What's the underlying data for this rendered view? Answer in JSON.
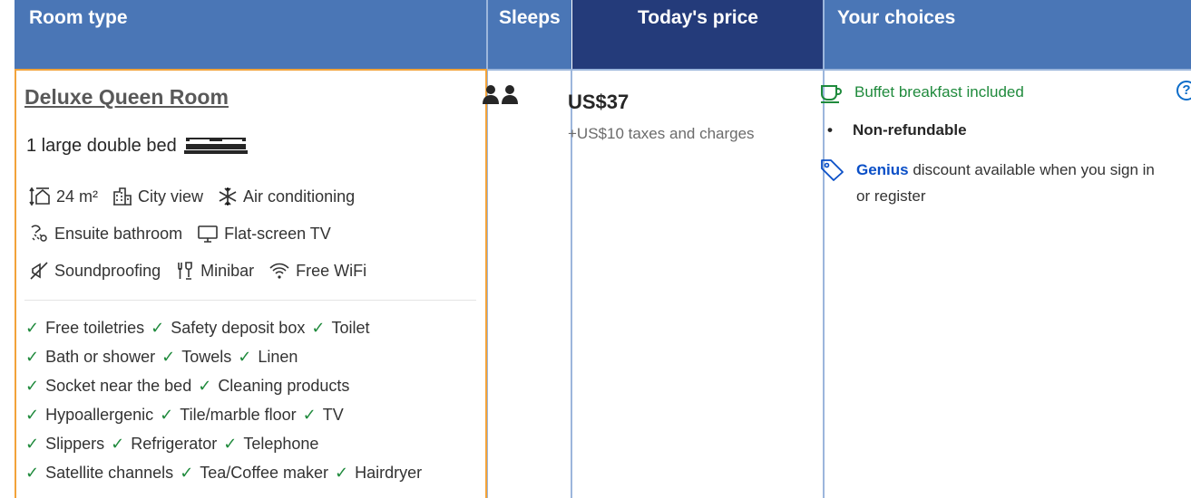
{
  "header": {
    "room_type": "Room type",
    "sleeps": "Sleeps",
    "todays_price": "Today's price",
    "your_choices": "Your choices"
  },
  "room": {
    "name": "Deluxe Queen Room",
    "bed": "1 large double bed",
    "facilities": [
      [
        {
          "icon": "room-size-icon",
          "label": "24 m²"
        },
        {
          "icon": "city-view-icon",
          "label": "City view"
        },
        {
          "icon": "air-conditioning-icon",
          "label": "Air conditioning"
        }
      ],
      [
        {
          "icon": "ensuite-bathroom-icon",
          "label": "Ensuite bathroom"
        },
        {
          "icon": "flat-screen-tv-icon",
          "label": "Flat-screen TV"
        }
      ],
      [
        {
          "icon": "soundproofing-icon",
          "label": "Soundproofing"
        },
        {
          "icon": "minibar-icon",
          "label": "Minibar"
        },
        {
          "icon": "wifi-icon",
          "label": "Free WiFi"
        }
      ]
    ],
    "amenities": [
      [
        "Free toiletries",
        "Safety deposit box",
        "Toilet"
      ],
      [
        "Bath or shower",
        "Towels",
        "Linen"
      ],
      [
        "Socket near the bed",
        "Cleaning products"
      ],
      [
        "Hypoallergenic",
        "Tile/marble floor",
        "TV"
      ],
      [
        "Slippers",
        "Refrigerator",
        "Telephone"
      ],
      [
        "Satellite channels",
        "Tea/Coffee maker",
        "Hairdryer"
      ]
    ]
  },
  "sleeps": {
    "icon": "two-persons-icon"
  },
  "price": {
    "amount": "US$37",
    "taxes": "+US$10 taxes and charges"
  },
  "choices": {
    "breakfast": "Buffet breakfast included",
    "refund": "Non-refundable",
    "genius_brand": "Genius",
    "genius_text": " discount available when you sign in or register",
    "help_glyph": "?"
  },
  "colors": {
    "header_blue": "#4a76b6",
    "header_price_dark": "#243b7a",
    "room_highlight": "#f2a33a",
    "check_green": "#1f8a3c",
    "genius_blue": "#0a4fc7"
  }
}
